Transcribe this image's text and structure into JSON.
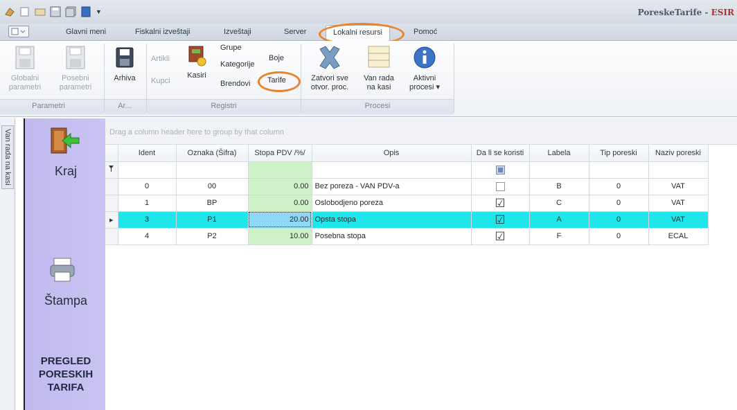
{
  "window": {
    "title_main": "PoreskeTarife - ",
    "title_accent": "ESIR"
  },
  "tabs": [
    {
      "label": "Glavni meni"
    },
    {
      "label": "Fiskalni izveštaji"
    },
    {
      "label": "Izveštaji"
    },
    {
      "label": "Server"
    },
    {
      "label": "Lokalni resursi"
    },
    {
      "label": "Pomoć"
    }
  ],
  "ribbon": {
    "parametri": {
      "label": "Parametri",
      "globalni": [
        "Globalni",
        "parametri"
      ],
      "posebni": [
        "Posebni",
        "parametri"
      ]
    },
    "arhiva": {
      "label": "Ar...",
      "button": "Arhiva"
    },
    "registri": {
      "label": "Registri",
      "artikli": "Artikli",
      "kupci": "Kupci",
      "kasiri": "Kasiri",
      "grupe": "Grupe",
      "kategorije": "Kategorije",
      "brendovi": "Brendovi",
      "boje": "Boje",
      "tarife": "Tarife"
    },
    "procesi": {
      "label": "Procesi",
      "zatvori": [
        "Zatvori sve",
        "otvor. proc."
      ],
      "vanrada": [
        "Van rada",
        "na kasi"
      ],
      "aktivni": [
        "Aktivni",
        "procesi ▾"
      ]
    }
  },
  "left": {
    "vertical_tab": "Van rada na kasi",
    "exit_label": "Kraj",
    "print_label": "Štampa",
    "heading": [
      "PREGLED",
      "PORESKIH",
      "TARIFA"
    ]
  },
  "grid": {
    "group_hint": "Drag a column header here to group by that column",
    "columns": [
      "Ident",
      "Oznaka (Šifra)",
      "Stopa PDV /%/",
      "Opis",
      "Da li se koristi",
      "Labela",
      "Tip poreski",
      "Naziv poreski"
    ],
    "rows": [
      {
        "ident": "0",
        "oznaka": "00",
        "stopa": "0.00",
        "opis": "Bez poreza - VAN PDV-a",
        "koristi": false,
        "labela": "B",
        "tip": "0",
        "naziv": "VAT"
      },
      {
        "ident": "1",
        "oznaka": "BP",
        "stopa": "0.00",
        "opis": "Oslobodjeno poreza",
        "koristi": true,
        "labela": "C",
        "tip": "0",
        "naziv": "VAT"
      },
      {
        "ident": "3",
        "oznaka": "P1",
        "stopa": "20.00",
        "opis": "Opsta stopa",
        "koristi": true,
        "labela": "A",
        "tip": "0",
        "naziv": "VAT"
      },
      {
        "ident": "4",
        "oznaka": "P2",
        "stopa": "10.00",
        "opis": "Posebna stopa",
        "koristi": true,
        "labela": "F",
        "tip": "0",
        "naziv": "ECAL"
      }
    ],
    "selected_row": 2
  }
}
